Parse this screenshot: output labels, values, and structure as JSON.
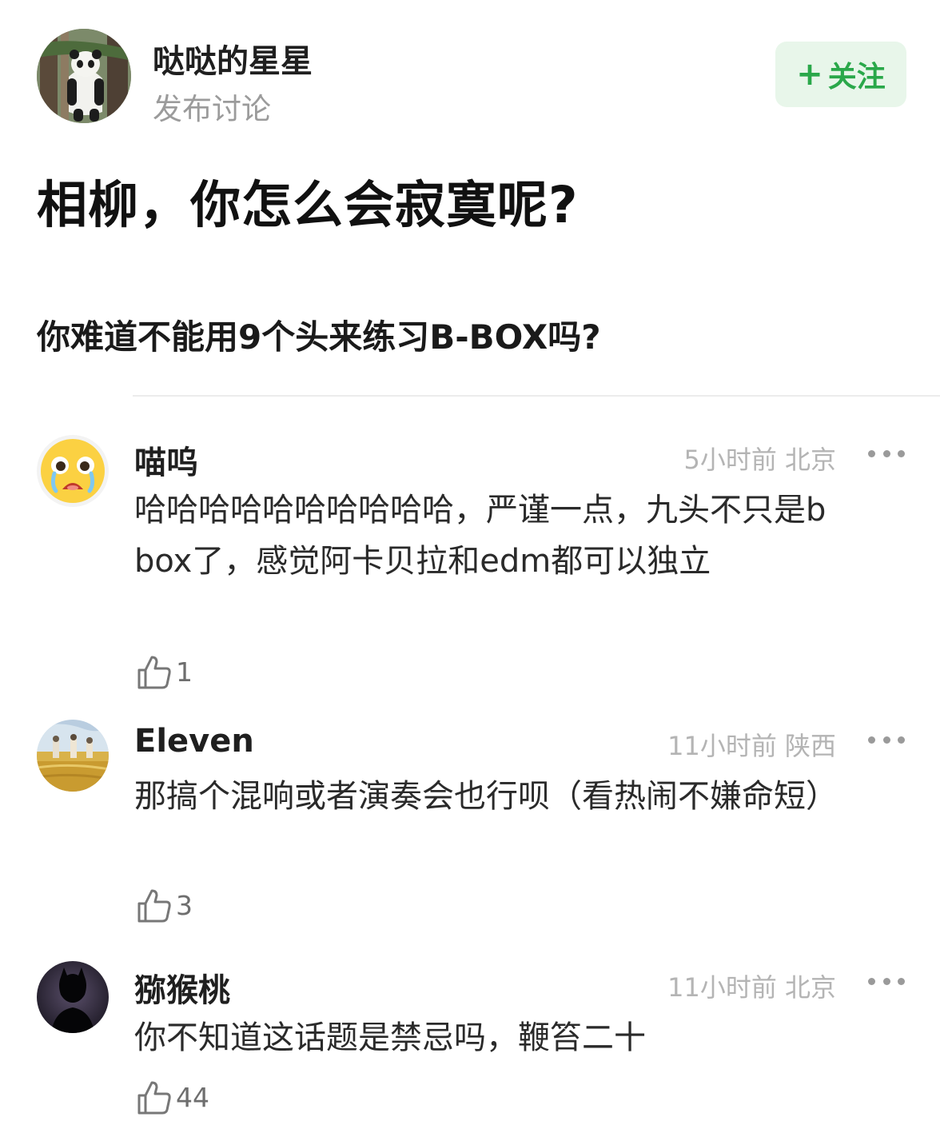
{
  "post": {
    "author_name": "哒哒的星星",
    "author_action": "发布讨论",
    "follow_plus": "+",
    "follow_label": "关注",
    "title": "相柳，你怎么会寂寞呢?",
    "body": "你难道不能用9个头来练习B-BOX吗?"
  },
  "comments": [
    {
      "name": "喵呜",
      "meta": "5小时前 北京",
      "text": "哈哈哈哈哈哈哈哈哈哈，严谨一点，九头不只是b box了，感觉阿卡贝拉和edm都可以独立",
      "likes": "1",
      "avatar": "crying-emoji-avatar"
    },
    {
      "name": "Eleven",
      "meta": "11小时前 陕西",
      "text": "那搞个混响或者演奏会也行呗（看热闹不嫌命短）",
      "likes": "3",
      "avatar": "wheat-field-painting-avatar"
    },
    {
      "name": "猕猴桃",
      "meta": "11小时前 北京",
      "text": "你不知道这话题是禁忌吗，鞭笞二十",
      "likes": "44",
      "avatar": "dark-silhouette-avatar"
    }
  ],
  "colors": {
    "follow_text": "#2aa84a",
    "follow_bg": "#e8f6ea",
    "meta_text": "#b4b4b4"
  }
}
